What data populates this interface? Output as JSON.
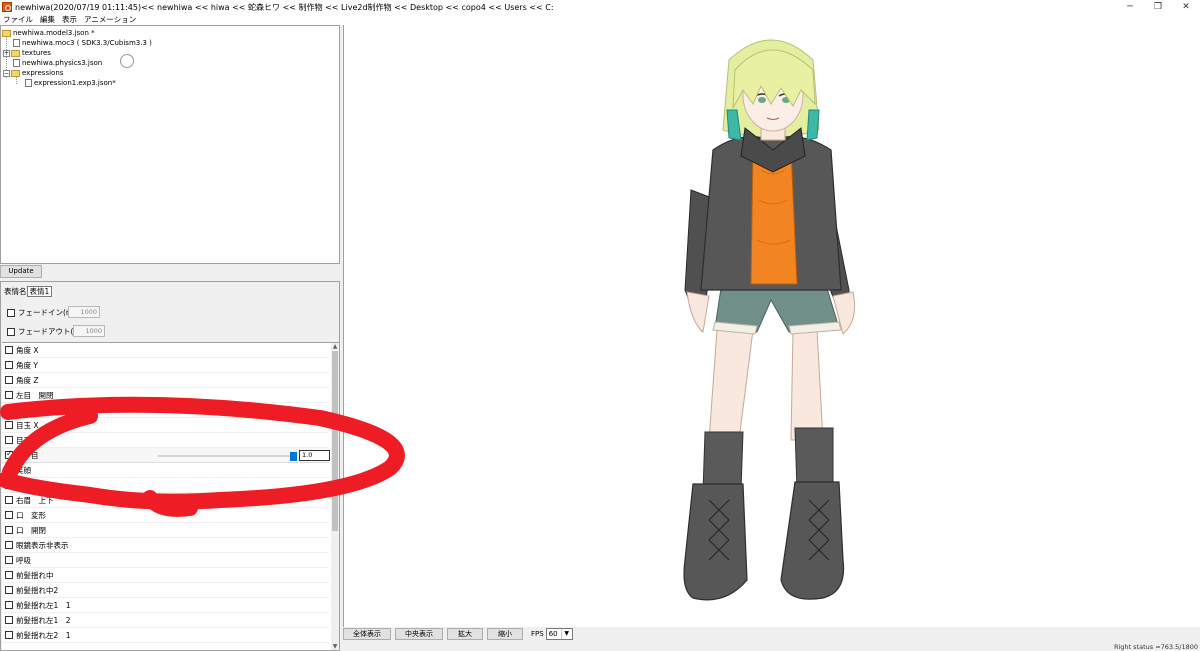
{
  "window": {
    "title": "newhiwa(2020/07/19 01:11:45)<< newhiwa << hiwa << 蛇森ヒワ << 制作物 << Live2d制作物 << Desktop << copo4 << Users << C:",
    "minimize_icon": "minimize-icon",
    "restore_icon": "restore-icon",
    "close_icon": "close-icon"
  },
  "menu": {
    "items": [
      "ファイル",
      "編集",
      "表示",
      "アニメーション"
    ]
  },
  "tree": {
    "root": "newhiwa.model3.json *",
    "moc": "newhiwa.moc3 ( SDK3.3/Cubism3.3 )",
    "textures": "textures",
    "physics": "newhiwa.physics3.json",
    "expressions": "expressions",
    "expression_file": "expression1.exp3.json*"
  },
  "update_button": "Update",
  "expression": {
    "name_label": "表情名",
    "name_value": "表情1",
    "fade_in_label": "フェードイン(ms)",
    "fade_in_value": "1000",
    "fade_out_label": "フェードアウト(ms)",
    "fade_out_value": "1000"
  },
  "params": [
    {
      "label": "角度 X",
      "checked": false
    },
    {
      "label": "角度 Y",
      "checked": false
    },
    {
      "label": "角度 Z",
      "checked": false
    },
    {
      "label": "左目　開閉",
      "checked": false
    },
    {
      "label": "右目　開閉",
      "checked": false
    },
    {
      "label": "目玉 X",
      "checked": false
    },
    {
      "label": "目玉 Y",
      "checked": false
    },
    {
      "label": "ジト目",
      "checked": true,
      "value": "1.0",
      "slider_fraction": 0.97
    },
    {
      "label": "笑顔",
      "checked": false
    },
    {
      "label": "左眉　上下",
      "checked": false
    },
    {
      "label": "右眉　上下",
      "checked": false
    },
    {
      "label": "口　変形",
      "checked": false
    },
    {
      "label": "口　開閉",
      "checked": false
    },
    {
      "label": "眼鏡表示非表示",
      "checked": false
    },
    {
      "label": "呼吸",
      "checked": false
    },
    {
      "label": "前髪揺れ中",
      "checked": false
    },
    {
      "label": "前髪揺れ中2",
      "checked": false
    },
    {
      "label": "前髪揺れ左1　1",
      "checked": false
    },
    {
      "label": "前髪揺れ左1　2",
      "checked": false
    },
    {
      "label": "前髪揺れ左2　1",
      "checked": false
    }
  ],
  "bottom": {
    "fit_all": "全体表示",
    "center": "中央表示",
    "zoom_in": "拡大",
    "zoom_out": "縮小",
    "fps_label": "FPS",
    "fps_value": "60"
  },
  "status": "Right status =763.5/1800",
  "annotation_color": "#ee1c24",
  "character_colors": {
    "hair": "#e8f0a0",
    "hair_tip": "#3cb8a8",
    "jacket": "#555555",
    "shirt": "#f08020",
    "shorts": "#6e8c86",
    "skin": "#f8e6dc",
    "boots": "#505050"
  }
}
